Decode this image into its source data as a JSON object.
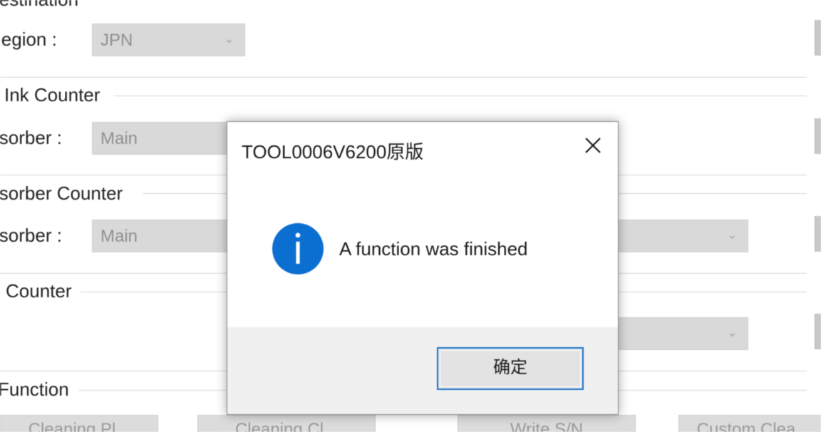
{
  "form": {
    "destination": {
      "title": "Destination",
      "region_label": "Region :",
      "region_value": "JPN"
    },
    "ink_counter": {
      "title": "Ink Counter",
      "absorber_label": "Absorber :",
      "absorber_value": "Main"
    },
    "absorber_counter": {
      "title": "Absorber Counter",
      "absorber_label": "Absorber :",
      "absorber_value": "Main"
    },
    "counter": {
      "title": "Counter"
    },
    "function": {
      "title": "Function",
      "buttons": [
        "Cleaning Pl...",
        "Cleaning Cl...",
        "Write S/N",
        "Custom Clea..."
      ]
    }
  },
  "dialog": {
    "title": "TOOL0006V6200原版",
    "message": "A function was finished",
    "ok_label": "确定",
    "icon": "info-icon",
    "icon_color": "#0b6fd2"
  }
}
